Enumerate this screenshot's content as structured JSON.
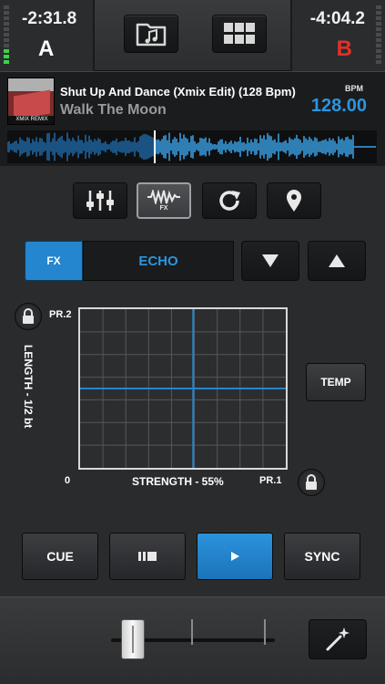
{
  "deck_a": {
    "time": "-2:31.8",
    "letter": "A",
    "vu_level": 0.3
  },
  "deck_b": {
    "time": "-4:04.2",
    "letter": "B",
    "vu_level": 0.0
  },
  "top_buttons": {
    "browse_icon": "music-folder-icon",
    "grid_icon": "grid-icon"
  },
  "track": {
    "title": "Shut Up And Dance (Xmix Edit) (128 Bpm)",
    "artist": "Walk The Moon",
    "bpm_label": "BPM",
    "bpm_value": "128.00",
    "cover_caption": "XMIX REMIX",
    "playhead": 0.4
  },
  "fx_icons": {
    "mixer_icon": "sliders-icon",
    "fx_icon": "waveform-icon",
    "fx_label": "FX",
    "loop_icon": "loop-icon",
    "cue_icon": "pin-icon"
  },
  "fx": {
    "tab_label": "FX",
    "effect_name": "ECHO"
  },
  "pad": {
    "pr2": "PR.2",
    "pr1": "PR.1",
    "y_axis_label": "LENGTH - 1/2 bt",
    "x_axis_label": "STRENGTH - 55%",
    "zero": "0",
    "temp_label": "TEMP",
    "x_value": 0.55,
    "y_value": 0.5
  },
  "transport": {
    "cue_label": "CUE",
    "pause_icon": "pause-stop-icon",
    "play_icon": "play-icon",
    "sync_label": "SYNC"
  },
  "crossfader": {
    "position": 0.07,
    "magic_icon": "magic-wand-icon"
  },
  "colors": {
    "accent": "#2386cf",
    "deck_b": "#e0312b",
    "vu_on": "#3fd14b"
  }
}
